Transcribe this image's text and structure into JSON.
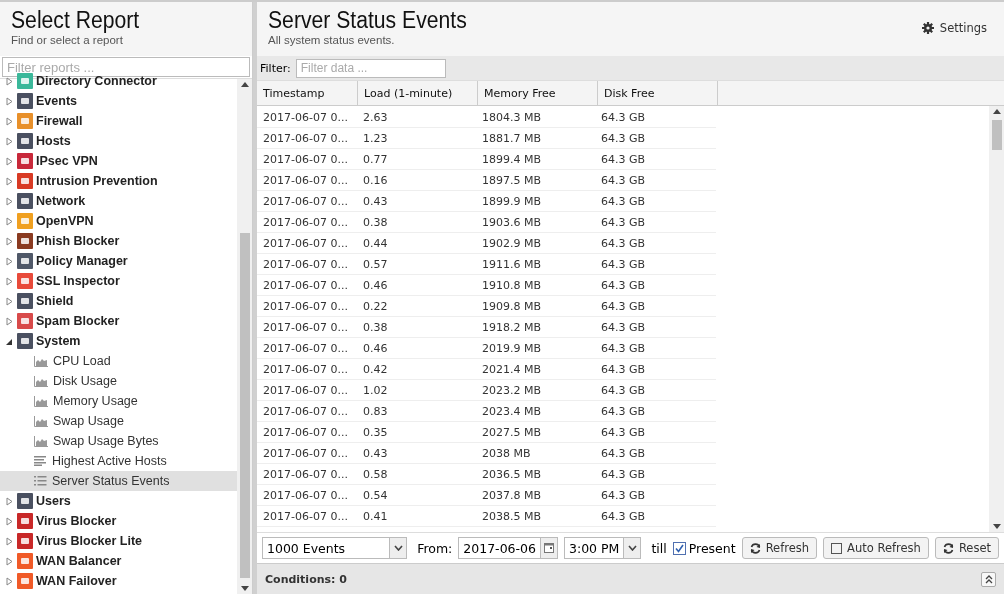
{
  "sidebar": {
    "title": "Select Report",
    "subtitle": "Find or select a report",
    "filter": {
      "placeholder": "Filter reports ..."
    },
    "items": [
      {
        "label": "Directory Connector",
        "color": "#3bb89a",
        "expanded": false,
        "selected": false
      },
      {
        "label": "Events",
        "color": "#4a5060",
        "expanded": false,
        "selected": false
      },
      {
        "label": "Firewall",
        "color": "#e8902a",
        "expanded": false,
        "selected": false
      },
      {
        "label": "Hosts",
        "color": "#4a5060",
        "expanded": false,
        "selected": false
      },
      {
        "label": "IPsec VPN",
        "color": "#c8283a",
        "expanded": false,
        "selected": false
      },
      {
        "label": "Intrusion Prevention",
        "color": "#d83a24",
        "expanded": false,
        "selected": false
      },
      {
        "label": "Network",
        "color": "#4a5060",
        "expanded": false,
        "selected": false
      },
      {
        "label": "OpenVPN",
        "color": "#f0a020",
        "expanded": false,
        "selected": false
      },
      {
        "label": "Phish Blocker",
        "color": "#8a3a20",
        "expanded": false,
        "selected": false
      },
      {
        "label": "Policy Manager",
        "color": "#505868",
        "expanded": false,
        "selected": false
      },
      {
        "label": "SSL Inspector",
        "color": "#e84a3a",
        "expanded": false,
        "selected": false
      },
      {
        "label": "Shield",
        "color": "#4a5060",
        "expanded": false,
        "selected": false
      },
      {
        "label": "Spam Blocker",
        "color": "#d84a4a",
        "expanded": false,
        "selected": false
      },
      {
        "label": "System",
        "color": "#4a5060",
        "expanded": true,
        "selected": false,
        "children": [
          {
            "label": "CPU Load",
            "kind": "area",
            "selected": false
          },
          {
            "label": "Disk Usage",
            "kind": "area",
            "selected": false
          },
          {
            "label": "Memory Usage",
            "kind": "area",
            "selected": false
          },
          {
            "label": "Swap Usage",
            "kind": "area",
            "selected": false
          },
          {
            "label": "Swap Usage Bytes",
            "kind": "area",
            "selected": false
          },
          {
            "label": "Highest Active Hosts",
            "kind": "bars",
            "selected": false
          },
          {
            "label": "Server Status Events",
            "kind": "list",
            "selected": true
          }
        ]
      },
      {
        "label": "Users",
        "color": "#4a5060",
        "expanded": false,
        "selected": false
      },
      {
        "label": "Virus Blocker",
        "color": "#c82828",
        "expanded": false,
        "selected": false
      },
      {
        "label": "Virus Blocker Lite",
        "color": "#c82828",
        "expanded": false,
        "selected": false
      },
      {
        "label": "WAN Balancer",
        "color": "#f05a28",
        "expanded": false,
        "selected": false
      },
      {
        "label": "WAN Failover",
        "color": "#f05a28",
        "expanded": false,
        "selected": false
      }
    ]
  },
  "report": {
    "title": "Server Status Events",
    "subtitle": "All system status events.",
    "settings": "Settings",
    "filter": {
      "label": "Filter:",
      "placeholder": "Filter data ..."
    },
    "table": {
      "columns": [
        "Timestamp",
        "Load (1-minute)",
        "Memory Free",
        "Disk Free"
      ],
      "rows": [
        [
          "2017-06-07 0...",
          "2.63",
          "1804.3 MB",
          "64.3 GB"
        ],
        [
          "2017-06-07 0...",
          "1.23",
          "1881.7 MB",
          "64.3 GB"
        ],
        [
          "2017-06-07 0...",
          "0.77",
          "1899.4 MB",
          "64.3 GB"
        ],
        [
          "2017-06-07 0...",
          "0.16",
          "1897.5 MB",
          "64.3 GB"
        ],
        [
          "2017-06-07 0...",
          "0.43",
          "1899.9 MB",
          "64.3 GB"
        ],
        [
          "2017-06-07 0...",
          "0.38",
          "1903.6 MB",
          "64.3 GB"
        ],
        [
          "2017-06-07 0...",
          "0.44",
          "1902.9 MB",
          "64.3 GB"
        ],
        [
          "2017-06-07 0...",
          "0.57",
          "1911.6 MB",
          "64.3 GB"
        ],
        [
          "2017-06-07 0...",
          "0.46",
          "1910.8 MB",
          "64.3 GB"
        ],
        [
          "2017-06-07 0...",
          "0.22",
          "1909.8 MB",
          "64.3 GB"
        ],
        [
          "2017-06-07 0...",
          "0.38",
          "1918.2 MB",
          "64.3 GB"
        ],
        [
          "2017-06-07 0...",
          "0.46",
          "2019.9 MB",
          "64.3 GB"
        ],
        [
          "2017-06-07 0...",
          "0.42",
          "2021.4 MB",
          "64.3 GB"
        ],
        [
          "2017-06-07 0...",
          "1.02",
          "2023.2 MB",
          "64.3 GB"
        ],
        [
          "2017-06-07 0...",
          "0.83",
          "2023.4 MB",
          "64.3 GB"
        ],
        [
          "2017-06-07 0...",
          "0.35",
          "2027.5 MB",
          "64.3 GB"
        ],
        [
          "2017-06-07 0...",
          "0.43",
          "2038 MB",
          "64.3 GB"
        ],
        [
          "2017-06-07 0...",
          "0.58",
          "2036.5 MB",
          "64.3 GB"
        ],
        [
          "2017-06-07 0...",
          "0.54",
          "2037.8 MB",
          "64.3 GB"
        ],
        [
          "2017-06-07 0...",
          "0.41",
          "2038.5 MB",
          "64.3 GB"
        ]
      ]
    },
    "toolbar": {
      "limit": "1000 Events",
      "from_label": "From:",
      "from_date": "2017-06-06",
      "from_time": "3:00 PM",
      "till_label": "till",
      "present": {
        "label": "Present",
        "checked": true
      },
      "refresh": "Refresh",
      "auto_refresh": {
        "label": "Auto Refresh",
        "checked": false
      },
      "reset": "Reset"
    },
    "conditions": "Conditions: 0"
  }
}
